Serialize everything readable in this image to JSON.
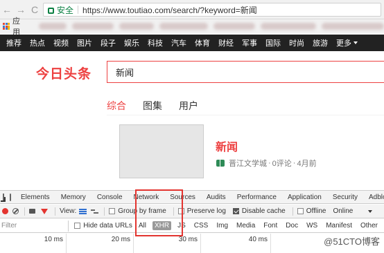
{
  "browser": {
    "secure_label": "安全",
    "url": "https://www.toutiao.com/search/?keyword=新闻",
    "bookmarks_apps": "应用",
    "back": "←",
    "forward": "→",
    "reload": "C"
  },
  "topnav": {
    "items": [
      "推荐",
      "热点",
      "视频",
      "图片",
      "段子",
      "娱乐",
      "科技",
      "汽车",
      "体育",
      "财经",
      "军事",
      "国际",
      "时尚",
      "旅游"
    ],
    "more": "更多"
  },
  "site": {
    "logo": "今日头条",
    "search_value": "新闻"
  },
  "tabs": {
    "items": [
      {
        "label": "综合",
        "active": true
      },
      {
        "label": "图集",
        "active": false
      },
      {
        "label": "用户",
        "active": false
      }
    ]
  },
  "result": {
    "title": "新闻",
    "source": "晋江文学城",
    "comments": "0评论",
    "time": "4月前",
    "dot": "·"
  },
  "devtools": {
    "tabs": [
      "Elements",
      "Memory",
      "Console",
      "Network",
      "Sources",
      "Audits",
      "Performance",
      "Application",
      "Security",
      "Adblo"
    ],
    "active_tab": "Network",
    "view_label": "View:",
    "group_by_frame": "Group by frame",
    "preserve_log": "Preserve log",
    "disable_cache": "Disable cache",
    "offline": "Offline",
    "throttle": "Online",
    "filter_placeholder": "Filter",
    "hide_data_urls": "Hide data URLs",
    "types": [
      "All",
      "XHR",
      "JS",
      "CSS",
      "Img",
      "Media",
      "Font",
      "Doc",
      "WS",
      "Manifest",
      "Other"
    ],
    "active_type": "XHR",
    "ticks": [
      "10 ms",
      "20 ms",
      "30 ms",
      "40 ms"
    ]
  },
  "watermark": "@51CTO博客",
  "colors": {
    "brand_red": "#ed4040",
    "nav_bg": "#222222",
    "highlight": "#e3342f"
  }
}
